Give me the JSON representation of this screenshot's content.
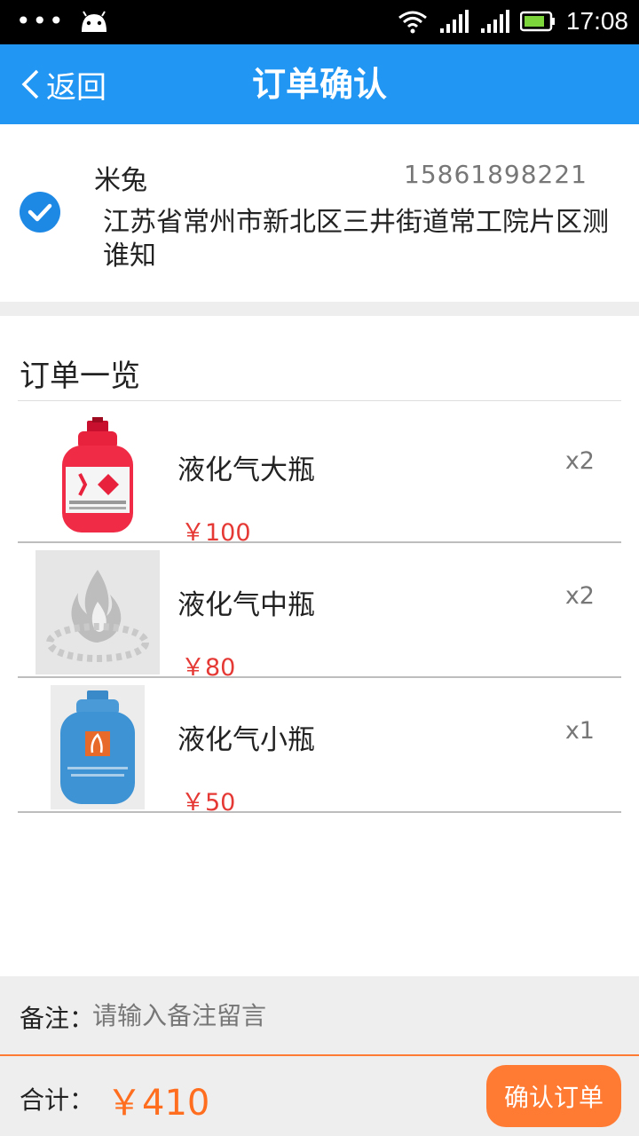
{
  "status_bar": {
    "time": "17:08",
    "icons": [
      "more-dots-icon",
      "android-icon",
      "wifi-icon",
      "signal-icon",
      "signal-icon",
      "battery-icon"
    ]
  },
  "header": {
    "back_label": "返回",
    "title": "订单确认"
  },
  "address": {
    "selected": true,
    "name": "米兔",
    "phone": "15861898221",
    "address": "江苏省常州市新北区三井街道常工院片区测谁知"
  },
  "orders": {
    "title": "订单一览",
    "items": [
      {
        "name": "液化气大瓶",
        "price": "￥100",
        "qty": "x2",
        "image": "red-gas-cylinder"
      },
      {
        "name": "液化气中瓶",
        "price": "￥80",
        "qty": "x2",
        "image": "placeholder-flame-logo"
      },
      {
        "name": "液化气小瓶",
        "price": "￥50",
        "qty": "x1",
        "image": "blue-gas-cylinder"
      }
    ]
  },
  "note": {
    "label": "备注：",
    "placeholder": "请输入备注留言",
    "value": ""
  },
  "footer": {
    "total_label": "合计：",
    "total_value": "￥410",
    "confirm_label": "确认订单"
  },
  "colors": {
    "primary": "#2196f3",
    "accent": "#ff7a33",
    "price": "#e53935"
  }
}
